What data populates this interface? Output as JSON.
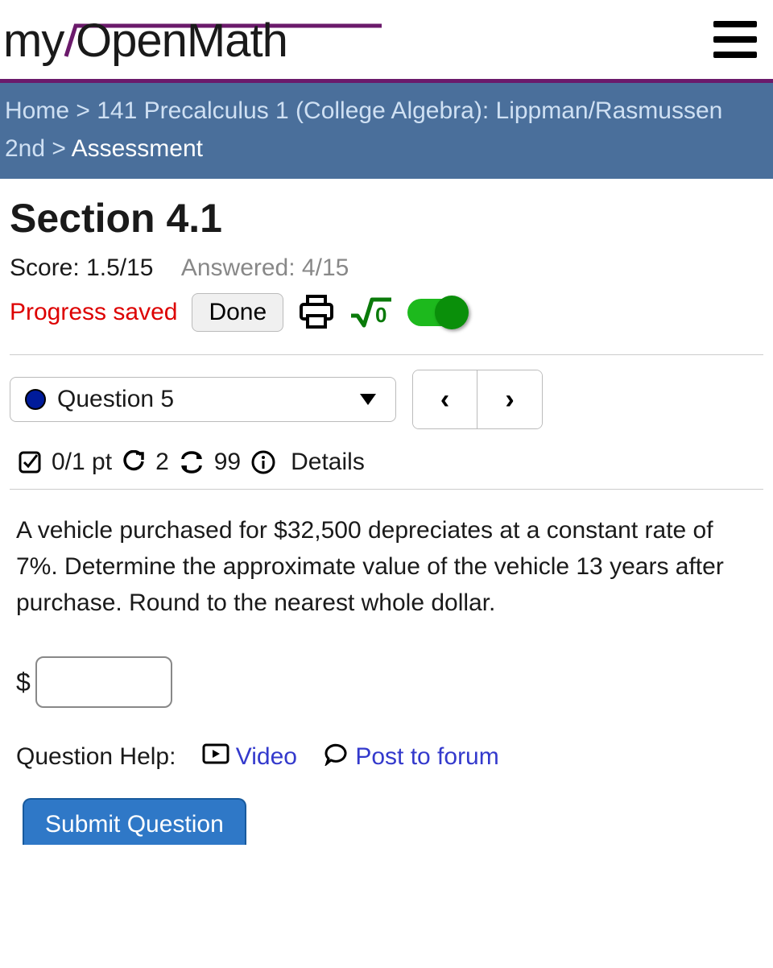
{
  "breadcrumb": {
    "home": "Home",
    "course": "141 Precalculus 1 (College Algebra): Lippman/Rasmussen 2nd",
    "current": "Assessment"
  },
  "section_title": "Section 4.1",
  "score": {
    "label": "Score:",
    "value": "1.5/15"
  },
  "answered": {
    "label": "Answered:",
    "value": "4/15"
  },
  "progress_saved": "Progress saved",
  "done_label": "Done",
  "question_selector": "Question 5",
  "prev_label": "‹",
  "next_label": "›",
  "meta": {
    "points": "0/1 pt",
    "tries": "2",
    "attempts": "99",
    "details": "Details"
  },
  "question_text": "A vehicle purchased for $32,500 depreciates at a constant rate of 7%. Determine the approximate value of the vehicle 13 years after purchase. Round to the nearest whole dollar.",
  "answer_prefix": "$",
  "help": {
    "label": "Question Help:",
    "video": "Video",
    "forum": "Post to forum"
  },
  "submit_label": "Submit Question"
}
